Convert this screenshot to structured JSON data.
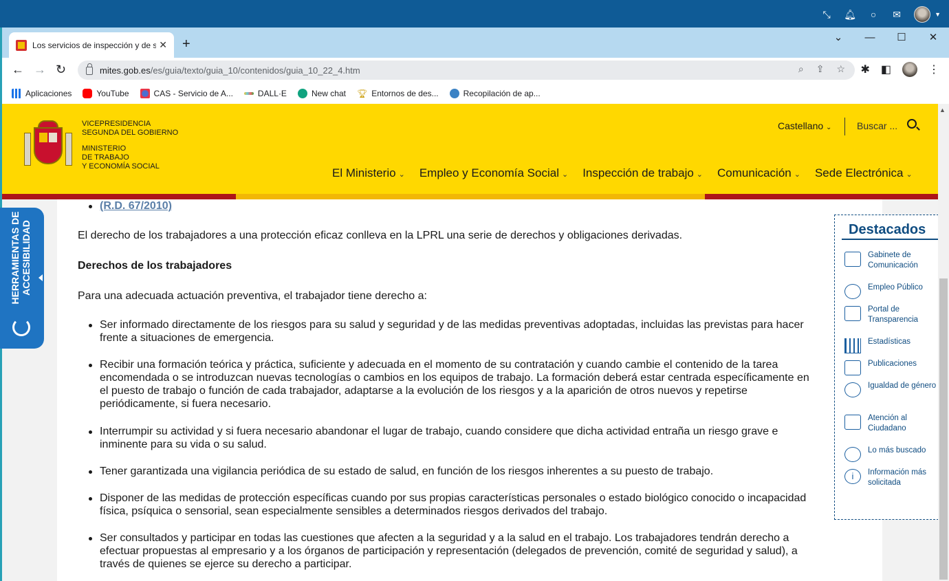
{
  "browser": {
    "tab_title": "Los servicios de inspección y de s",
    "url_host": "mites.gob.es",
    "url_path": "/es/guia/texto/guia_10/contenidos/guia_10_22_4.htm",
    "bookmarks": [
      {
        "label": "Aplicaciones",
        "icon": "apps-grid-icon",
        "color": "#1a73e8"
      },
      {
        "label": "YouTube",
        "icon": "youtube-icon",
        "color": "#ff0000"
      },
      {
        "label": "CAS - Servicio de A...",
        "icon": "cas-icon",
        "color": "#4a6fd1"
      },
      {
        "label": "DALL·E",
        "icon": "dalle-icon",
        "color": "#f4c430"
      },
      {
        "label": "New chat",
        "icon": "chatgpt-icon",
        "color": "#10a37f"
      },
      {
        "label": "Entornos de des...",
        "icon": "trophy-icon",
        "color": "#c99a00"
      },
      {
        "label": "Recopilación de ap...",
        "icon": "cloud-icon",
        "color": "#3b82c4"
      }
    ]
  },
  "header": {
    "ministry_line1": "VICEPRESIDENCIA",
    "ministry_line2": "SEGUNDA DEL GOBIERNO",
    "ministry_line3": "MINISTERIO",
    "ministry_line4": "DE TRABAJO",
    "ministry_line5": "Y ECONOMÍA SOCIAL",
    "language": "Castellano",
    "search_placeholder": "Buscar ...",
    "nav": [
      "El Ministerio",
      "Empleo y Economía Social",
      "Inspección de trabajo",
      "Comunicación",
      "Sede Electrónica"
    ],
    "brand_red": "#ad1519",
    "brand_yellow": "#ffd800"
  },
  "accessibility": {
    "label_line1": "HERRAMIENTAS DE",
    "label_line2": "ACCESIBILIDAD"
  },
  "content": {
    "top_link": "(R.D. 67/2010)",
    "intro": "El derecho de los trabajadores a una protección eficaz conlleva en la LPRL una serie de derechos y obligaciones derivadas.",
    "heading": "Derechos de los trabajadores",
    "lead": "Para una adecuada actuación preventiva, el trabajador tiene derecho a:",
    "rights": [
      "Ser informado directamente de los riesgos para su salud y seguridad y de las medidas preventivas adoptadas, incluidas las previstas para hacer frente a situaciones de emergencia.",
      "Recibir una formación teórica y práctica, suficiente y adecuada en el momento de su contratación y cuando cambie el contenido de la tarea encomendada o se introduzcan nuevas tecnologías o cambios en los equipos de trabajo. La formación deberá estar centrada específicamente en el puesto de trabajo o función de cada trabajador, adaptarse a la evolución de los riesgos y a la aparición de otros nuevos y repetirse periódicamente, si fuera necesario.",
      "Interrumpir su actividad y si fuera necesario abandonar el lugar de trabajo, cuando considere que dicha actividad entraña un riesgo grave e inminente para su vida o su salud.",
      "Tener garantizada una vigilancia periódica de su estado de salud, en función de los riesgos inherentes a su puesto de trabajo.",
      "Disponer de las medidas de protección específicas cuando por sus propias características personales o estado biológico conocido o incapacidad física, psíquica o sensorial, sean especialmente sensibles a determinados riesgos derivados del trabajo.",
      "Ser consultados y participar en todas las cuestiones que afecten a la seguridad y a la salud en el trabajo. Los trabajadores tendrán derecho a efectuar propuestas al empresario y a los órganos de participación y representación (delegados de prevención, comité de seguridad y salud), a través de quienes se ejerce su derecho a participar."
    ]
  },
  "destacados": {
    "title": "Destacados",
    "items": [
      {
        "label": "Gabinete de Comunicación",
        "icon": "newspaper-icon"
      },
      {
        "label": "Empleo Público",
        "icon": "people-icon"
      },
      {
        "label": "Portal de Transparencia",
        "icon": "building-icon"
      },
      {
        "label": "Estadísticas",
        "icon": "bar-chart-icon"
      },
      {
        "label": "Publicaciones",
        "icon": "book-icon"
      },
      {
        "label": "Igualdad de género",
        "icon": "couple-icon"
      },
      {
        "label": "Atención al Ciudadano",
        "icon": "support-icon"
      },
      {
        "label": "Lo más buscado",
        "icon": "eye-icon"
      },
      {
        "label": "Información más solicitada",
        "icon": "info-icon"
      }
    ]
  }
}
